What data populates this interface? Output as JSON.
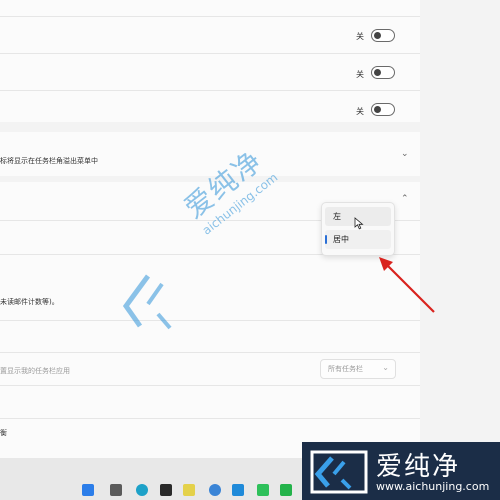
{
  "toggles": [
    {
      "state": "关"
    },
    {
      "state": "关"
    },
    {
      "state": "关"
    }
  ],
  "overflow_row": {
    "description": "标将显示在任务栏角溢出菜单中"
  },
  "alignment_dropdown": {
    "options": [
      "左",
      "居中"
    ],
    "selected": "居中",
    "hovered": "左"
  },
  "badge_row": {
    "description": "未读邮件计数等)。"
  },
  "multi_monitor_row": {
    "description": "置显示我的任务栏应用",
    "combo_value": "所有任务栏"
  },
  "bottom_row": {
    "text": "衡"
  },
  "watermark": {
    "brand": "爱纯净",
    "url": "aichunjing.com"
  },
  "logo": {
    "brand": "爱纯净",
    "url": "www.aichunjing.com"
  },
  "taskbar": {
    "icons": [
      "windows-start-icon",
      "task-view-icon",
      "edge-icon",
      "qq-icon",
      "ev-icon",
      "sogou-icon",
      "qq-penguin-icon",
      "feishu-icon",
      "wechat-icon",
      "app-icon"
    ]
  }
}
